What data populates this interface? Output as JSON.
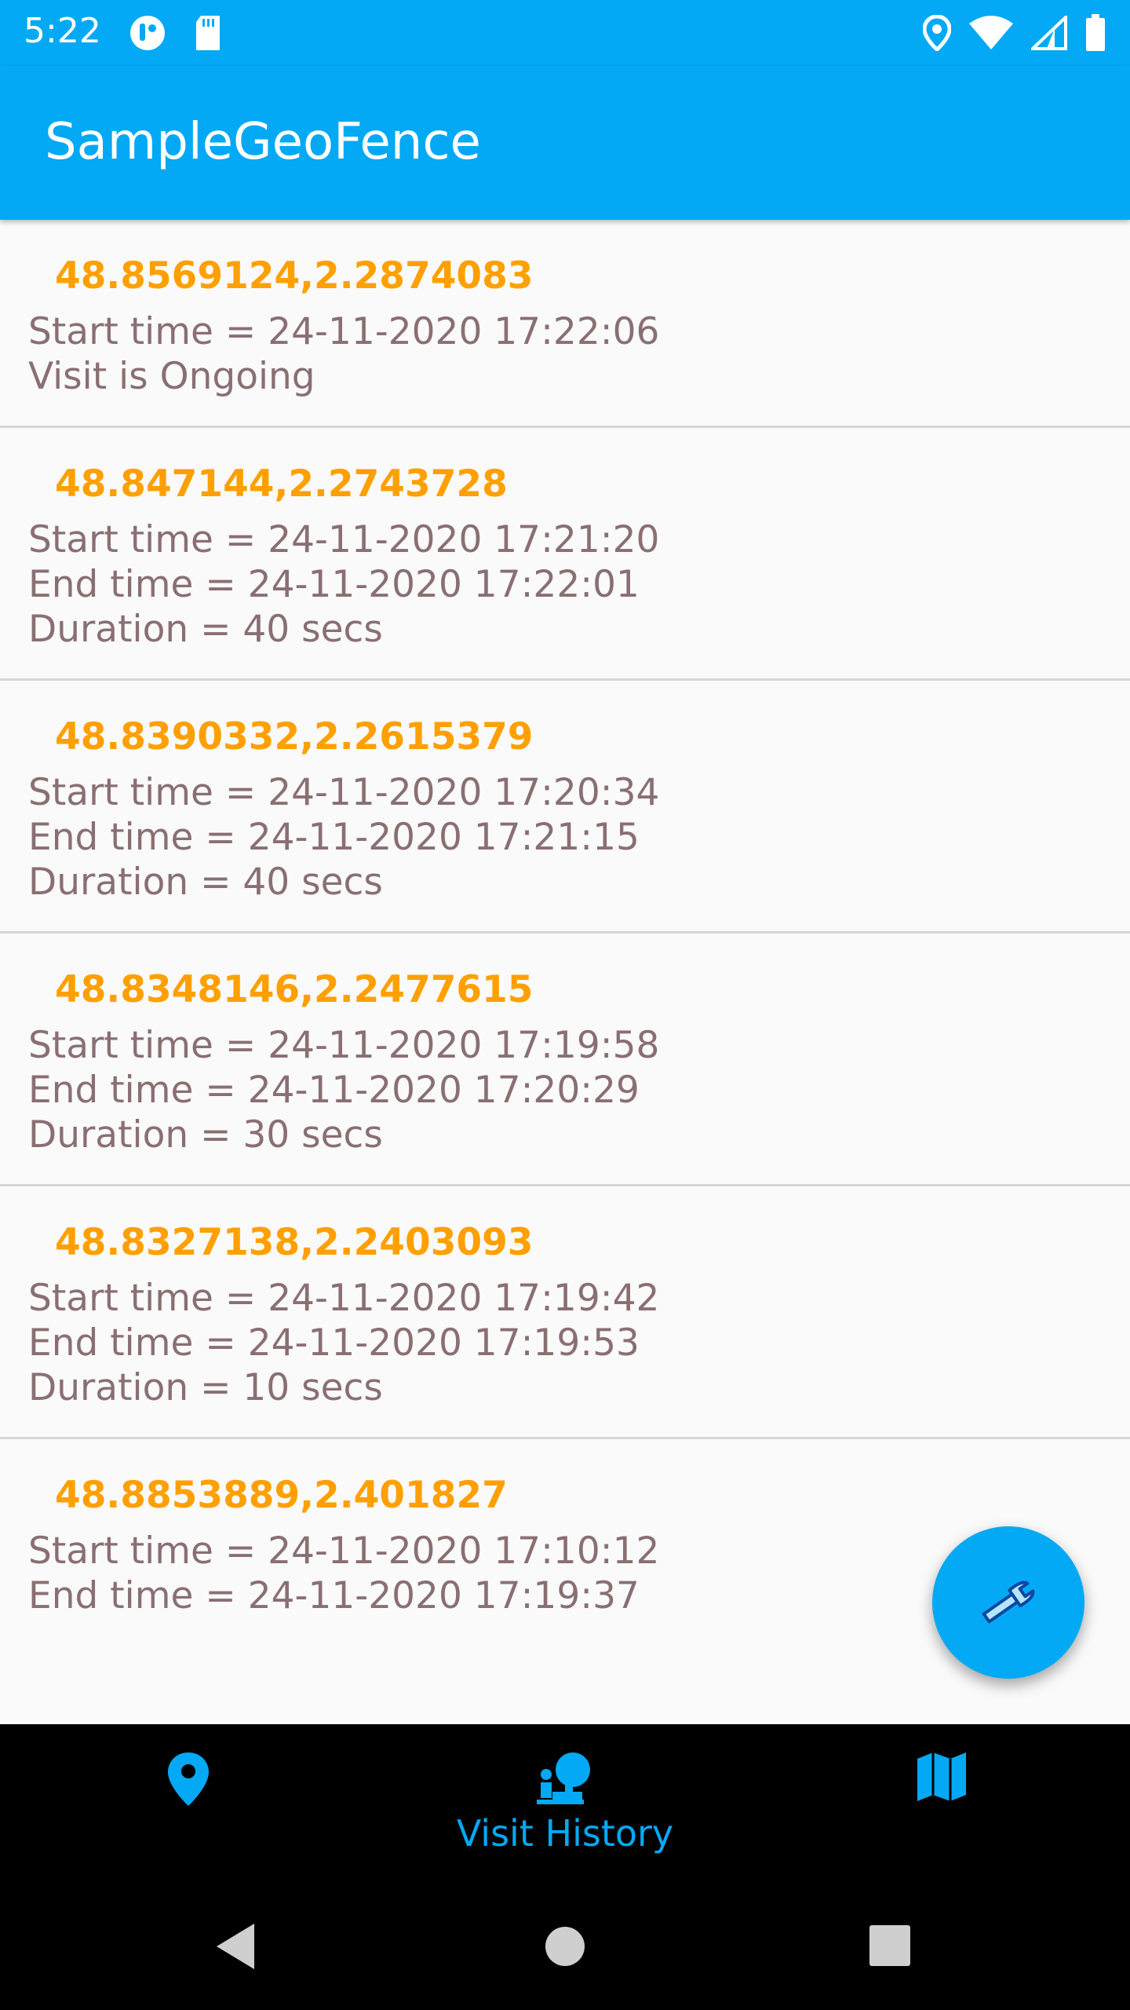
{
  "status_bar": {
    "time": "5:22",
    "left_icons": [
      "notification-icon",
      "sd-card-icon"
    ],
    "right_icons": [
      "location-icon",
      "wifi-icon",
      "signal-icon",
      "battery-icon"
    ]
  },
  "app_bar": {
    "title": "SampleGeoFence"
  },
  "visits": [
    {
      "coords": "48.8569124,2.2874083",
      "lines": [
        "Start time = 24-11-2020 17:22:06",
        "Visit is Ongoing"
      ]
    },
    {
      "coords": "48.847144,2.2743728",
      "lines": [
        "Start time = 24-11-2020 17:21:20",
        "End time = 24-11-2020 17:22:01",
        "Duration = 40 secs"
      ]
    },
    {
      "coords": "48.8390332,2.2615379",
      "lines": [
        "Start time = 24-11-2020 17:20:34",
        "End time = 24-11-2020 17:21:15",
        "Duration = 40 secs"
      ]
    },
    {
      "coords": "48.8348146,2.2477615",
      "lines": [
        "Start time = 24-11-2020 17:19:58",
        "End time = 24-11-2020 17:20:29",
        "Duration = 30 secs"
      ]
    },
    {
      "coords": "48.8327138,2.2403093",
      "lines": [
        "Start time = 24-11-2020 17:19:42",
        "End time = 24-11-2020 17:19:53",
        "Duration = 10 secs"
      ]
    },
    {
      "coords": "48.8853889,2.401827",
      "lines": [
        "Start time = 24-11-2020 17:10:12",
        "End time = 24-11-2020 17:19:37"
      ]
    }
  ],
  "fab": {
    "icon": "wrench-icon"
  },
  "bottom_nav": {
    "items": [
      {
        "icon": "location-pin-icon",
        "label": ""
      },
      {
        "icon": "visit-history-icon",
        "label": "Visit History"
      },
      {
        "icon": "map-icon",
        "label": ""
      }
    ]
  },
  "system_nav": {
    "icons": [
      "back-icon",
      "home-icon",
      "recents-icon"
    ]
  },
  "colors": {
    "primary": "#03a9f4",
    "coords": "#ffa000",
    "text": "#8a6f72",
    "divider": "#d6d6d6",
    "background": "#fafafa"
  }
}
